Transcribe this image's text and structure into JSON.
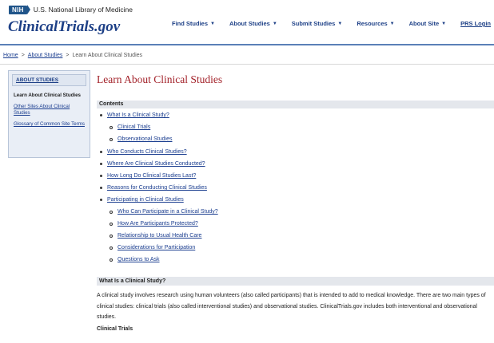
{
  "header": {
    "nih_badge": "NIH",
    "nlm_text": "U.S. National Library of Medicine",
    "brand": "ClinicalTrials.gov",
    "nav": [
      {
        "label": "Find Studies",
        "caret": "▼"
      },
      {
        "label": "About Studies",
        "caret": "▼"
      },
      {
        "label": "Submit Studies",
        "caret": "▼"
      },
      {
        "label": "Resources",
        "caret": "▼"
      },
      {
        "label": "About Site",
        "caret": "▼"
      },
      {
        "label": "PRS Login",
        "caret": ""
      }
    ]
  },
  "breadcrumb": {
    "items": [
      "Home",
      "About Studies",
      "Learn About Clinical Studies"
    ],
    "separator": ">"
  },
  "sidebar": {
    "heading": "ABOUT STUDIES",
    "items": [
      {
        "label": "Learn About Clinical Studies"
      },
      {
        "label": "Other Sites About Clinical Studies"
      },
      {
        "label": "Glossary of Common Site Terms"
      }
    ]
  },
  "main": {
    "title": "Learn About Clinical Studies",
    "contents_label": "Contents",
    "toc": [
      {
        "label": "What Is a Clinical Study?",
        "level": 1
      },
      {
        "label": "Clinical Trials",
        "level": 2
      },
      {
        "label": "Observational Studies",
        "level": 2
      },
      {
        "label": "Who Conducts Clinical Studies?",
        "level": 1
      },
      {
        "label": "Where Are Clinical Studies Conducted?",
        "level": 1
      },
      {
        "label": "How Long Do Clinical Studies Last?",
        "level": 1
      },
      {
        "label": "Reasons for Conducting Clinical Studies",
        "level": 1
      },
      {
        "label": "Participating in Clinical Studies",
        "level": 1
      },
      {
        "label": "Who Can Participate in a Clinical Study?",
        "level": 2
      },
      {
        "label": "How Are Participants Protected?",
        "level": 2
      },
      {
        "label": "Relationship to Usual Health Care",
        "level": 2
      },
      {
        "label": "Considerations for Participation",
        "level": 2
      },
      {
        "label": "Questions to Ask",
        "level": 2
      }
    ],
    "section_heading": "What Is a Clinical Study?",
    "section_body": "A clinical study involves research using human volunteers (also called participants) that is intended to add to medical knowledge. There are two main types of clinical studies: clinical trials (also called interventional studies) and observational studies. ClinicalTrials.gov includes both interventional and observational studies.",
    "subheading": "Clinical Trials"
  }
}
